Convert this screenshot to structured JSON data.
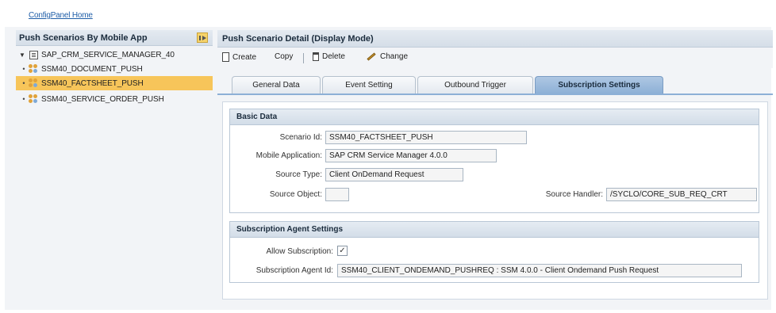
{
  "topbar": {
    "home_link": "ConfigPanel Home"
  },
  "left_panel": {
    "title": "Push Scenarios By Mobile App",
    "tree": {
      "root_label": "SAP_CRM_SERVICE_MANAGER_40",
      "items": [
        {
          "label": "SSM40_DOCUMENT_PUSH"
        },
        {
          "label": "SSM40_FACTSHEET_PUSH"
        },
        {
          "label": "SSM40_SERVICE_ORDER_PUSH"
        }
      ]
    }
  },
  "detail": {
    "title": "Push Scenario Detail (Display Mode)",
    "toolbar": {
      "create": "Create",
      "copy": "Copy",
      "delete": "Delete",
      "change": "Change"
    },
    "tabs": [
      {
        "label": "General Data"
      },
      {
        "label": "Event Setting"
      },
      {
        "label": "Outbound Trigger"
      },
      {
        "label": "Subscription Settings"
      }
    ],
    "basic_data": {
      "title": "Basic Data",
      "scenario_id_label": "Scenario Id:",
      "scenario_id": "SSM40_FACTSHEET_PUSH",
      "mobile_app_label": "Mobile Application:",
      "mobile_app": "SAP CRM Service Manager 4.0.0",
      "source_type_label": "Source Type:",
      "source_type": "Client OnDemand Request",
      "source_object_label": "Source Object:",
      "source_object": "",
      "source_handler_label": "Source Handler:",
      "source_handler": "/SYCLO/CORE_SUB_REQ_CRT"
    },
    "subscription": {
      "title": "Subscription Agent Settings",
      "allow_label": "Allow Subscription:",
      "allow_checked": "✓",
      "agent_id_label": "Subscription Agent Id:",
      "agent_id": "SSM40_CLIENT_ONDEMAND_PUSHREQ : SSM 4.0.0 - Client Ondemand Push Request"
    }
  }
}
